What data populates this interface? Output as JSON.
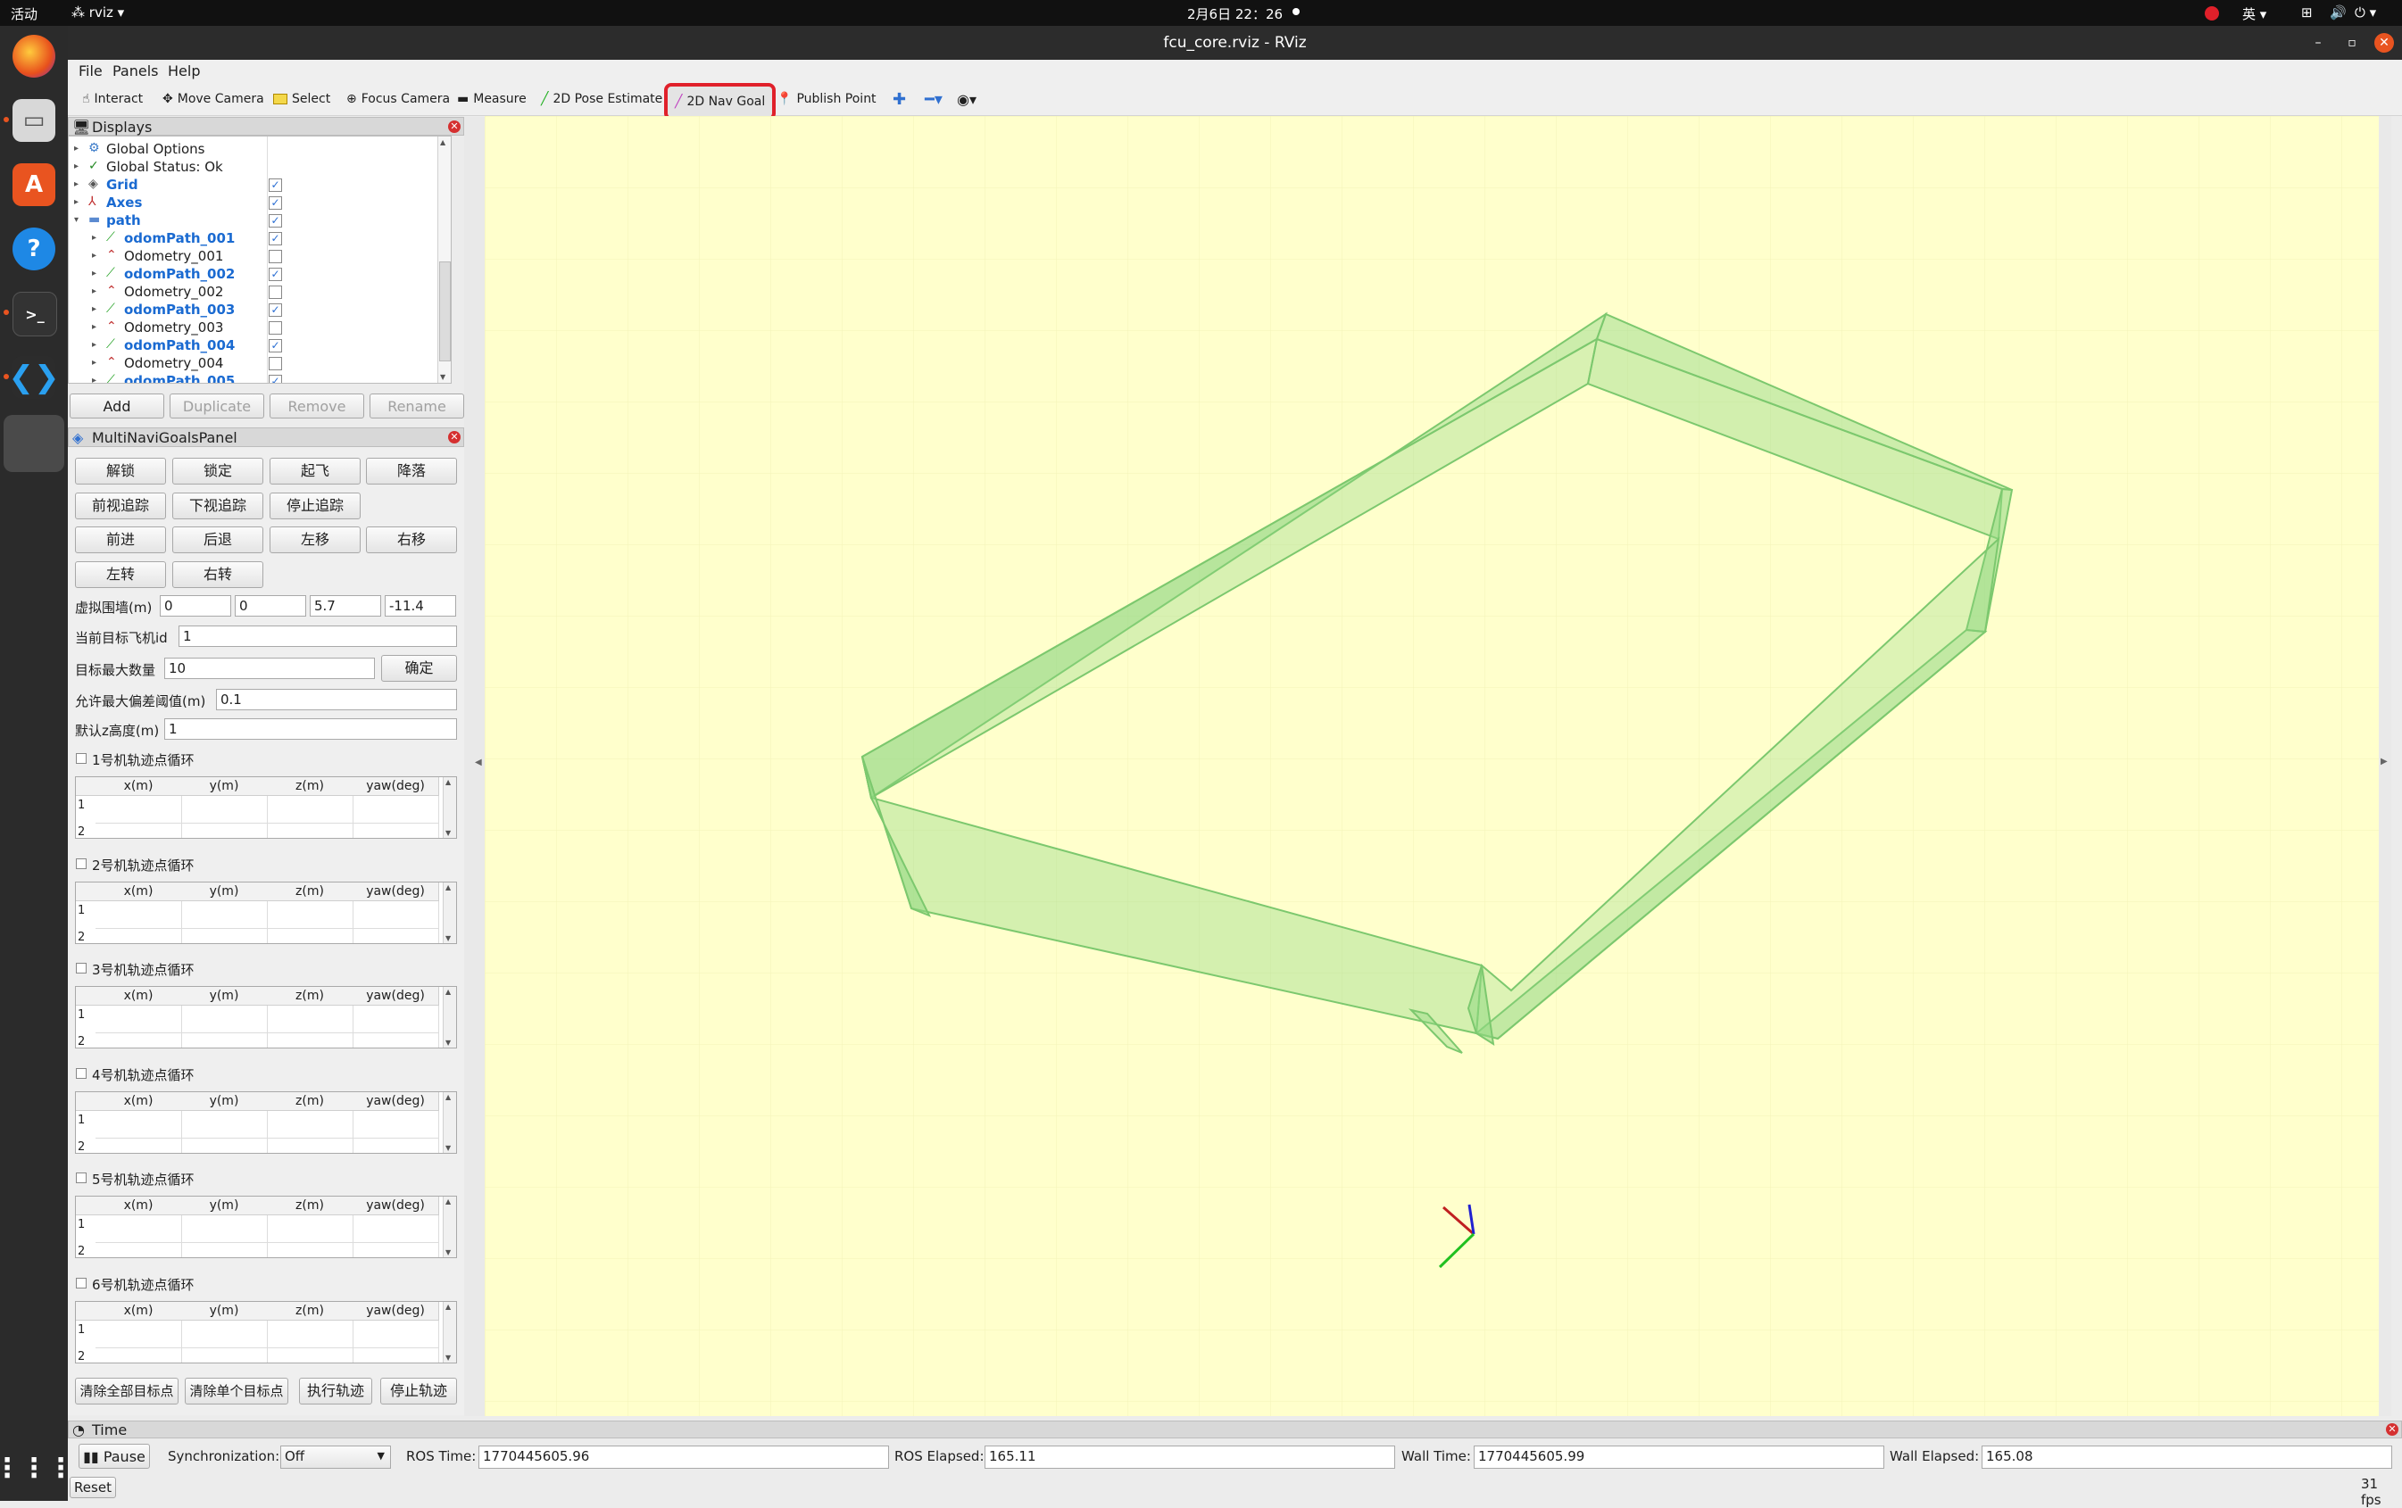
{
  "system": {
    "activities": "活动",
    "app_menu": "rviz",
    "clock": "2月6日  22：26",
    "input_method": "英"
  },
  "window": {
    "title": "fcu_core.rviz - RViz"
  },
  "menu": [
    "File",
    "Panels",
    "Help"
  ],
  "toolbar": {
    "tools": [
      "Interact",
      "Move Camera",
      "Select",
      "Focus Camera",
      "Measure",
      "2D Pose Estimate",
      "2D Nav Goal",
      "Publish Point"
    ],
    "active": "2D Nav Goal",
    "highlight_color": "#e0202a"
  },
  "displays": {
    "title": "Displays",
    "items": [
      {
        "label": "Global Options",
        "checked": null
      },
      {
        "label": "Global Status: Ok",
        "checked": null
      },
      {
        "label": "Grid",
        "checked": true
      },
      {
        "label": "Axes",
        "checked": true
      },
      {
        "label": "path",
        "checked": true
      },
      {
        "label": "odomPath_001",
        "checked": true
      },
      {
        "label": "Odometry_001",
        "checked": false
      },
      {
        "label": "odomPath_002",
        "checked": true
      },
      {
        "label": "Odometry_002",
        "checked": false
      },
      {
        "label": "odomPath_003",
        "checked": true
      },
      {
        "label": "Odometry_003",
        "checked": false
      },
      {
        "label": "odomPath_004",
        "checked": true
      },
      {
        "label": "Odometry_004",
        "checked": false
      },
      {
        "label": "odomPath_005",
        "checked": true
      }
    ],
    "buttons": [
      "Add",
      "Duplicate",
      "Remove",
      "Rename"
    ]
  },
  "multi_panel": {
    "title": "MultiNaviGoalsPanel",
    "buttons_row1": [
      "解锁",
      "锁定",
      "起飞",
      "降落"
    ],
    "buttons_row2": [
      "前视追踪",
      "下视追踪",
      "停止追踪"
    ],
    "buttons_row3": [
      "前进",
      "后退",
      "左移",
      "右移"
    ],
    "buttons_row4": [
      "左转",
      "右转"
    ],
    "fence_label": "虚拟围墙(m)",
    "fence_values": [
      "0",
      "0",
      "5.7",
      "-11.4"
    ],
    "target_id_label": "当前目标飞机id",
    "target_id_value": "1",
    "max_targets_label": "目标最大数量",
    "max_targets_value": "10",
    "confirm_label": "确定",
    "tolerance_label": "允许最大偏差阈值(m)",
    "tolerance_value": "0.1",
    "default_z_label": "默认z高度(m)",
    "default_z_value": "1",
    "columns": [
      "x(m)",
      "y(m)",
      "z(m)",
      "yaw(deg)"
    ],
    "loops": [
      "1号机轨迹点循环",
      "2号机轨迹点循环",
      "3号机轨迹点循环",
      "4号机轨迹点循环",
      "5号机轨迹点循环",
      "6号机轨迹点循环"
    ],
    "row_numbers": [
      "1",
      "2"
    ],
    "bottom_buttons": [
      "清除全部目标点",
      "清除单个目标点",
      "执行轨迹",
      "停止轨迹"
    ]
  },
  "viewport": {
    "background": "#ffffcc",
    "fence_color": "#8fd882",
    "fps": "31 fps"
  },
  "time_panel": {
    "title": "Time",
    "pause_label": "Pause",
    "sync_label": "Synchronization:",
    "sync_value": "Off",
    "ros_time_label": "ROS Time:",
    "ros_time": "1770445605.96",
    "ros_elapsed_label": "ROS Elapsed:",
    "ros_elapsed": "165.11",
    "wall_time_label": "Wall Time:",
    "wall_time": "1770445605.99",
    "wall_elapsed_label": "Wall Elapsed:",
    "wall_elapsed": "165.08",
    "reset_label": "Reset"
  }
}
